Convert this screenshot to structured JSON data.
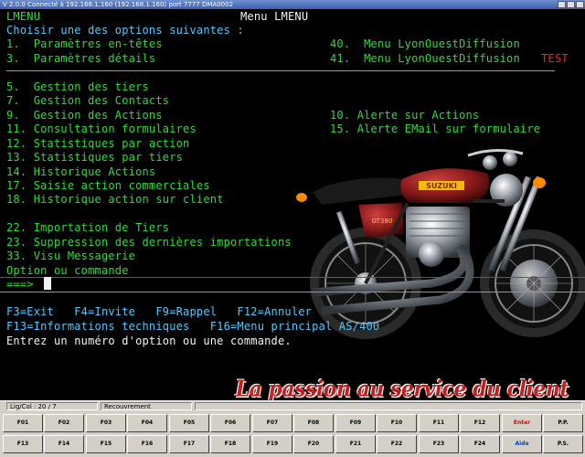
{
  "window": {
    "title": "V 2.0.0 Connecté à 192.168.1.160 (192.168.1.160) port 7777  DMA0002"
  },
  "screen": {
    "program_id": "LMENU",
    "title": "Menu LMENU",
    "prompt": "Choisir une des options suivantes :",
    "options_left_top": [
      "1.  Paramètres en-têtes",
      "3.  Paramètres détails"
    ],
    "options_right_top": [
      "40.  Menu LyonOuestDiffusion",
      "41.  Menu LyonOuestDiffusion"
    ],
    "test_tag": "TEST",
    "options_left": [
      "5.  Gestion des tiers",
      "7.  Gestion des Contacts",
      "9.  Gestion des Actions",
      "11. Consultation formulaires",
      "12. Statistiques par action",
      "13. Statistiques par tiers",
      "14. Historique Actions",
      "17. Saisie action commerciales",
      "18. Historique action sur client"
    ],
    "options_right": [
      "10. Alerte sur Actions",
      "15. Alerte EMail sur formulaire"
    ],
    "options_bottom": [
      "22. Importation de Tiers",
      "23. Suppression des dernières importations",
      "33. Visu Messagerie"
    ],
    "command_label": "Option ou commande",
    "command_prompt": "===>",
    "command_value": "",
    "fkeys_line1": "F3=Exit   F4=Invite   F9=Rappel   F12=Annuler",
    "fkeys_line2": "F13=Informations techniques   F16=Menu principal AS/400",
    "message": "Entrez un numéro d'option ou une commande.",
    "slogan": "La passion au service du client",
    "brand": "SUZUKI",
    "model": "GT380"
  },
  "status": {
    "position": "Lig/Col : 20 / 7",
    "mode": "Recouvrement"
  },
  "keys_row1": [
    "F01",
    "F02",
    "F03",
    "F04",
    "F05",
    "F06",
    "F07",
    "F08",
    "F09",
    "F10",
    "F11",
    "F12",
    "Enter",
    "P.P."
  ],
  "keys_row2": [
    "F13",
    "F14",
    "F15",
    "F16",
    "F17",
    "F18",
    "F19",
    "F20",
    "F21",
    "F22",
    "F23",
    "F24",
    "Aide",
    "P.S."
  ],
  "colors": {
    "green": "#2fdc3a",
    "cyan": "#55c8ff",
    "white": "#f4f4f4",
    "red": "#ff2020",
    "slogan": "#c02020"
  }
}
